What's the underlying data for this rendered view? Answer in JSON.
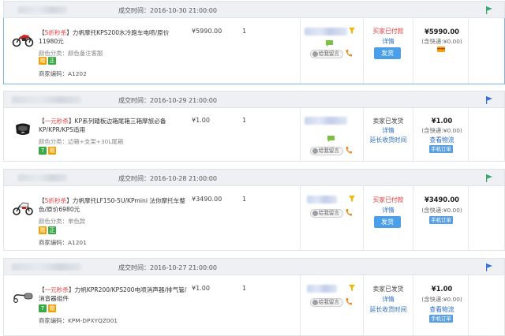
{
  "colors": {
    "accent": "#4a9fe8",
    "link": "#2b6cc4",
    "price_red": "#e4393c",
    "flag_green": "#2ea86b",
    "flag_blue": "#2f6fd6"
  },
  "orders": [
    {
      "time": "成交时间：2016-10-30 21:00:00",
      "flag_icon": "flag-green-icon",
      "tag_open": "【",
      "tag_red": "5折秒杀",
      "title": "】力帆摩托KPS200水冷跑车电喷/原价11980元",
      "sku": "颜色分类：颜色备注客服",
      "badge_1": "赠",
      "badge_2": "正",
      "merchant": "商家编码：A1202",
      "unit_price": "¥5990.00",
      "qty": "1",
      "ww_label": "给我留言",
      "status": "买家已付款",
      "detail": "详情",
      "ship_button": "发货",
      "total": "¥5990.00",
      "shipping": "(含快递:¥0.00)"
    },
    {
      "time": "成交时间：2016-10-29 21:00:00",
      "flag_icon": "flag-blue-icon",
      "tag_open": "【",
      "tag_red": "一元秒杀",
      "title": "】KP系列踏板边箱尾箱三箱摩旅必备KP/KPR/KPS适用",
      "sku": "颜色分类：边箱+支架+30L尾箱",
      "badge_1": "7",
      "badge_2": "赠",
      "unit_price": "¥1.00",
      "qty": "1",
      "ww_label": "给我留言",
      "status": "卖家已发货",
      "detail": "详情",
      "extend": "延长收货时间",
      "total": "¥1.00",
      "shipping": "(含快递:¥0.00)",
      "logistics": "查看物流",
      "phone_order": "手机订单"
    },
    {
      "time": "成交时间：2016-10-28 21:00:00",
      "flag_icon": "flag-green-icon",
      "tag_open": "【",
      "tag_red": "5折秒杀",
      "title": "】力帆摩托LF150-5U/KPmini 法你摩托车整色/原价6980元",
      "sku": "颜色分类：单色款",
      "badge_1": "赠",
      "badge_2": "正",
      "merchant": "商家编码：A1201",
      "unit_price": "¥3490.00",
      "qty": "1",
      "ww_label": "给我留言",
      "status": "买家已付款",
      "detail": "详情",
      "ship_button": "发货",
      "total": "¥3490.00",
      "shipping": "(含快递:¥0.00)",
      "phone_order": "手机订单"
    },
    {
      "time": "成交时间：2016-10-27 21:00:00",
      "flag_icon": "flag-blue-icon",
      "tag_open": "【",
      "tag_red": "一元秒杀",
      "title": "】力帆KPR200/KPS200电喷消声器/排气管/消音器组件",
      "badge_1": "7",
      "badge_2": "赠",
      "merchant": "商家编码：KPM-DPXYQZ001",
      "unit_price": "¥1.00",
      "qty": "1",
      "ww_label": "给我留言",
      "status": "卖家已发货",
      "detail": "详情",
      "extend": "延长收货时间",
      "total": "¥1.00",
      "shipping": "(含快递:¥0.00)",
      "logistics": "查看物流",
      "phone_order": "手机订单"
    }
  ]
}
